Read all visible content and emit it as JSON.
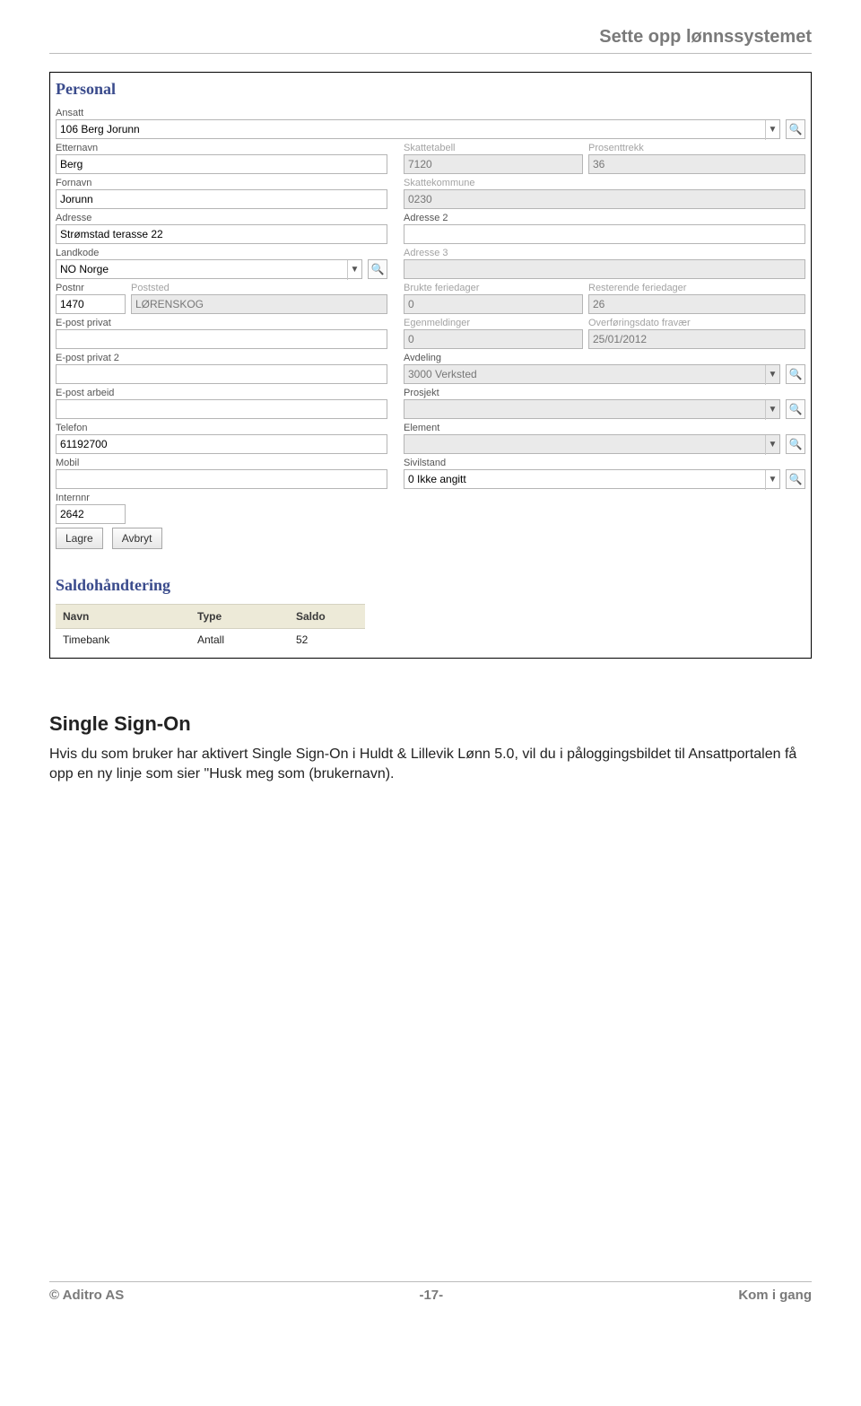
{
  "doc_header": "Sette opp lønnssystemet",
  "screenshot": {
    "section_personal": "Personal",
    "ansatt": {
      "label": "Ansatt",
      "value": "106 Berg Jorunn"
    },
    "etternavn": {
      "label": "Etternavn",
      "value": "Berg"
    },
    "fornavn": {
      "label": "Fornavn",
      "value": "Jorunn"
    },
    "adresse": {
      "label": "Adresse",
      "value": "Strømstad terasse 22"
    },
    "landkode": {
      "label": "Landkode",
      "value": "NO Norge"
    },
    "postnr": {
      "label": "Postnr",
      "value": "1470"
    },
    "poststed": {
      "label": "Poststed",
      "value": "LØRENSKOG"
    },
    "epost_privat": {
      "label": "E-post privat",
      "value": ""
    },
    "epost_privat2": {
      "label": "E-post privat 2",
      "value": ""
    },
    "epost_arbeid": {
      "label": "E-post arbeid",
      "value": ""
    },
    "telefon": {
      "label": "Telefon",
      "value": "61192700"
    },
    "mobil": {
      "label": "Mobil",
      "value": ""
    },
    "internnr": {
      "label": "Internnr",
      "value": "2642"
    },
    "skattetabell": {
      "label": "Skattetabell",
      "value": "7120"
    },
    "prosenttrekk": {
      "label": "Prosenttrekk",
      "value": "36"
    },
    "skattekommune": {
      "label": "Skattekommune",
      "value": "0230"
    },
    "adresse2": {
      "label": "Adresse 2",
      "value": ""
    },
    "adresse3": {
      "label": "Adresse 3",
      "value": ""
    },
    "brukte_feriedager": {
      "label": "Brukte feriedager",
      "value": "0"
    },
    "resterende_feriedager": {
      "label": "Resterende feriedager",
      "value": "26"
    },
    "egenmeldinger": {
      "label": "Egenmeldinger",
      "value": "0"
    },
    "overforingsdato": {
      "label": "Overføringsdato fravær",
      "value": "25/01/2012"
    },
    "avdeling": {
      "label": "Avdeling",
      "value": "3000 Verksted"
    },
    "prosjekt": {
      "label": "Prosjekt",
      "value": ""
    },
    "element": {
      "label": "Element",
      "value": ""
    },
    "sivilstand": {
      "label": "Sivilstand",
      "value": "0 Ikke angitt"
    },
    "btn_lagre": "Lagre",
    "btn_avbryt": "Avbryt",
    "section_saldo": "Saldohåndtering",
    "saldo_headers": {
      "navn": "Navn",
      "type": "Type",
      "saldo": "Saldo"
    },
    "saldo_row": {
      "navn": "Timebank",
      "type": "Antall",
      "saldo": "52"
    }
  },
  "body": {
    "heading": "Single Sign-On",
    "para": "Hvis du som bruker har aktivert Single Sign-On i Huldt & Lillevik Lønn 5.0, vil du i påloggingsbildet til Ansattportalen få opp en ny linje som sier \"Husk meg som (brukernavn)."
  },
  "footer": {
    "left": "© Aditro AS",
    "center": "-17-",
    "right": "Kom i gang"
  }
}
